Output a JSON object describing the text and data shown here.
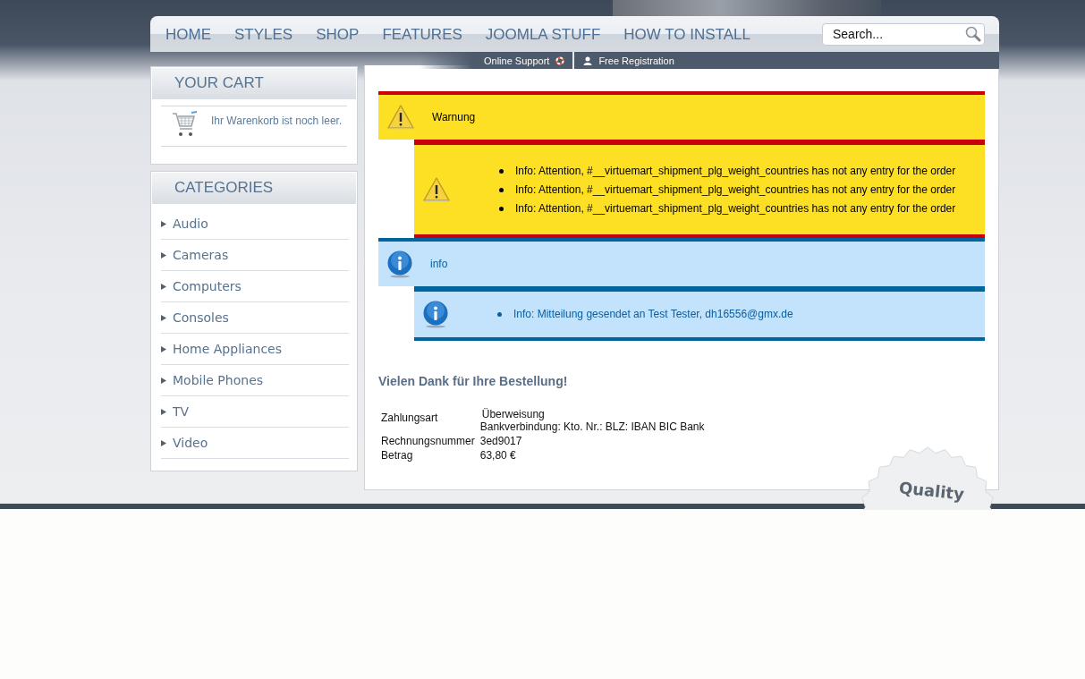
{
  "nav": {
    "items": [
      {
        "label": "HOME"
      },
      {
        "label": "STYLES"
      },
      {
        "label": "SHOP"
      },
      {
        "label": "FEATURES"
      },
      {
        "label": "JOOMLA STUFF"
      },
      {
        "label": "HOW TO INSTALL"
      }
    ]
  },
  "search": {
    "placeholder": "Search..."
  },
  "top_links": [
    "Online Support",
    "Free Registration"
  ],
  "cart": {
    "title": "YOUR CART",
    "message": "Ihr Warenkorb ist noch leer."
  },
  "categories": {
    "title": "CATEGORIES",
    "items": [
      "Audio",
      "Cameras",
      "Computers",
      "Consoles",
      "Home Appliances",
      "Mobile Phones",
      "TV",
      "Video"
    ]
  },
  "messages": [
    {
      "kind": "warning",
      "title": "Warnung",
      "items": [
        "Info: Attention, #__virtuemart_shipment_plg_weight_countries has not any entry for the order",
        "Info: Attention, #__virtuemart_shipment_plg_weight_countries has not any entry for the order",
        "Info: Attention, #__virtuemart_shipment_plg_weight_countries has not any entry for the order"
      ]
    },
    {
      "kind": "info",
      "title": "info",
      "items": [
        "Info: Mitteilung gesendet an Test Tester, dh16556@gmx.de"
      ]
    }
  ],
  "order": {
    "heading": "Vielen Dank für Ihre Bestellung!",
    "rows": [
      {
        "label": "Zahlungsart",
        "value": "Überweisung",
        "detail": "Bankverbindung: Kto. Nr.: BLZ: IBAN BIC Bank"
      },
      {
        "label": "Rechnungsnummer",
        "value": "3ed9017"
      },
      {
        "label": "Betrag",
        "value": "63,80 €"
      }
    ]
  },
  "badge": {
    "text": "Quality"
  }
}
